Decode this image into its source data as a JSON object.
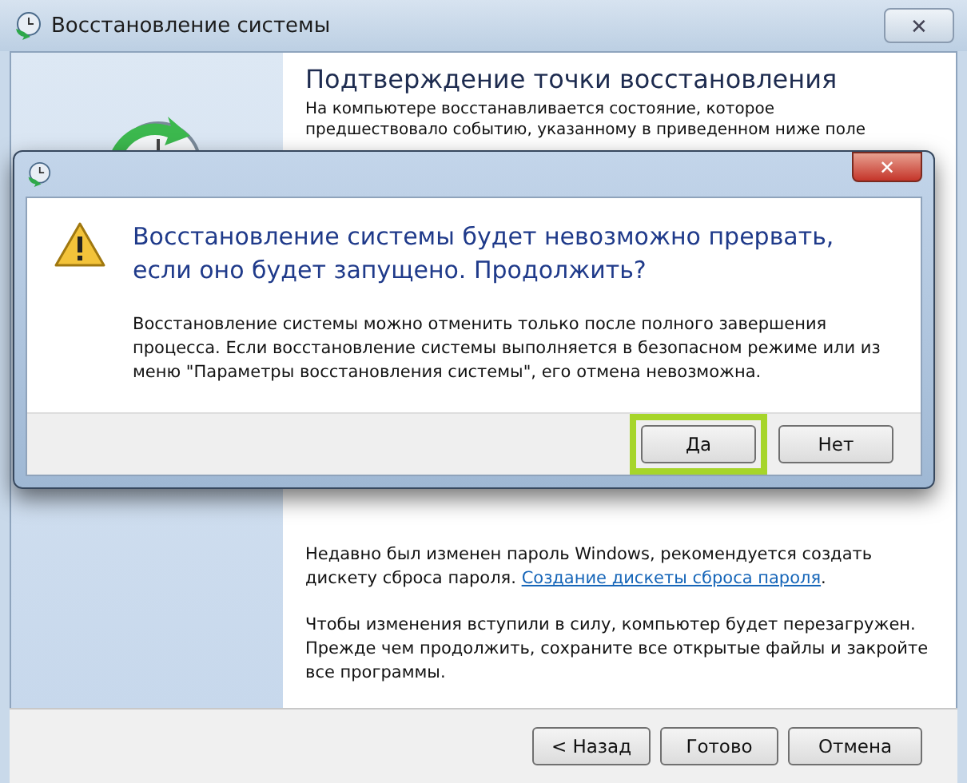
{
  "window": {
    "title": "Восстановление системы",
    "close": "✕"
  },
  "page": {
    "heading": "Подтверждение точки восстановления",
    "intro_lines": [
      "На компьютере восстанавливается состояние, которое",
      "предшествовало событию, указанному в приведенном ниже поле"
    ],
    "password_note": {
      "text": "Недавно был изменен пароль Windows, рекомендуется создать дискету сброса пароля.",
      "link": "Создание дискеты сброса пароля",
      "after": "."
    },
    "restart_note": "Чтобы изменения вступили в силу, компьютер будет перезагружен. Прежде чем продолжить, сохраните все открытые файлы и закройте все программы."
  },
  "buttons": [
    {
      "label": "< Назад"
    },
    {
      "label": "Готово"
    },
    {
      "label": "Отмена"
    }
  ],
  "dialog": {
    "close": "✕",
    "heading": "Восстановление системы будет невозможно прервать, если оно будет запущено. Продолжить?",
    "body": "Восстановление системы можно отменить только после полного завершения процесса. Если восстановление системы выполняется в безопасном режиме или из меню \"Параметры восстановления системы\", его отмена невозможна.",
    "buttons": [
      {
        "label": "Да",
        "highlighted": true
      },
      {
        "label": "Нет",
        "highlighted": false
      }
    ]
  }
}
